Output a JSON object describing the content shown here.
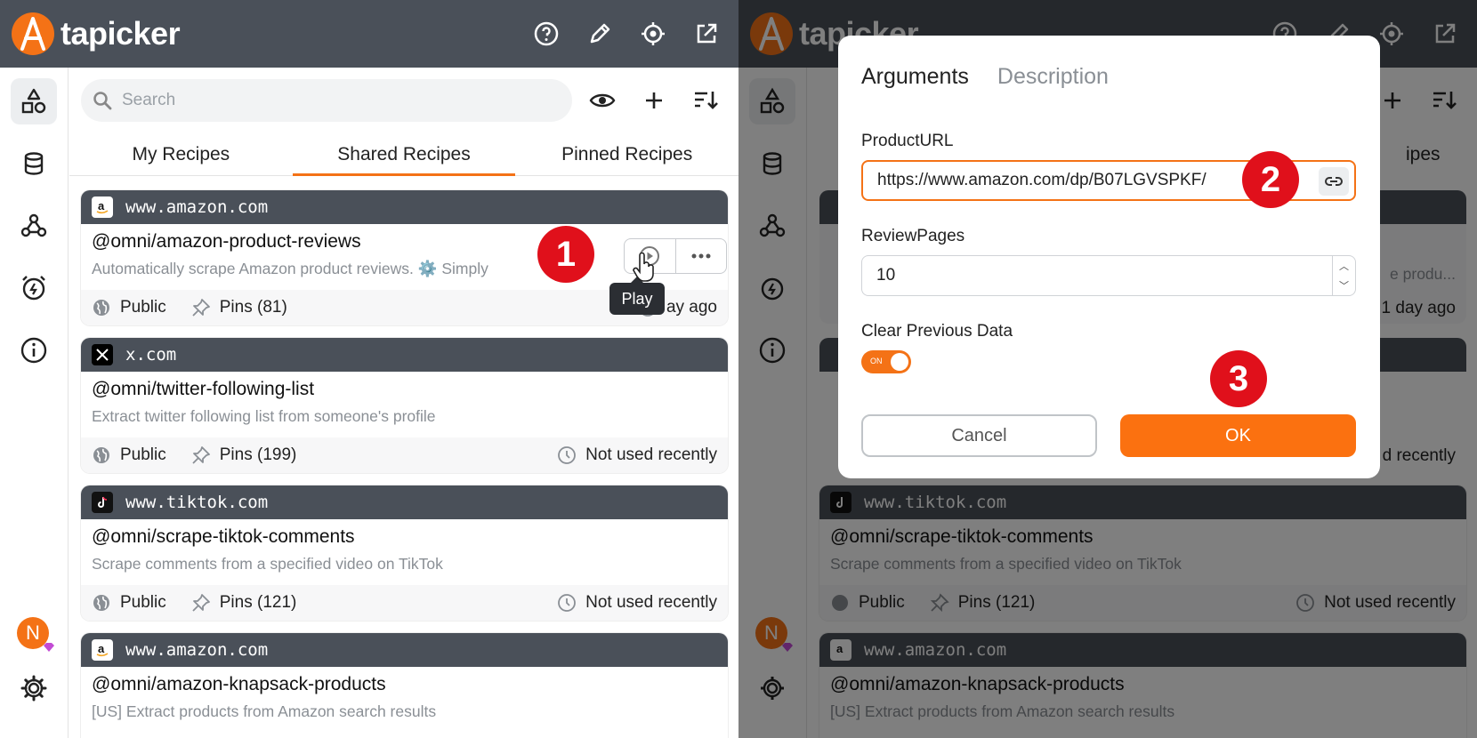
{
  "app": {
    "name": "tapicker"
  },
  "search": {
    "placeholder": "Search"
  },
  "tabs": [
    "My Recipes",
    "Shared Recipes",
    "Pinned Recipes"
  ],
  "recipes": [
    {
      "domain": "www.amazon.com",
      "title": "@omni/amazon-product-reviews",
      "desc": "Automatically scrape Amazon product reviews. ⚙️ Simply",
      "visibility": "Public",
      "pins": "Pins (81)",
      "usage": "1 day ago",
      "usage_partial": "ay ago"
    },
    {
      "domain": "x.com",
      "title": "@omni/twitter-following-list",
      "desc": "Extract twitter following list from someone's profile",
      "visibility": "Public",
      "pins": "Pins (199)",
      "usage": "Not used recently"
    },
    {
      "domain": "www.tiktok.com",
      "title": "@omni/scrape-tiktok-comments",
      "desc": "Scrape comments from a specified video on TikTok",
      "visibility": "Public",
      "pins": "Pins (121)",
      "usage": "Not used recently"
    },
    {
      "domain": "www.amazon.com",
      "title": "@omni/amazon-knapsack-products",
      "desc": "[US] Extract products from Amazon search results"
    }
  ],
  "right_bg": {
    "tab_partial": "ipes",
    "desc_partial": "e produ...",
    "usage1": "1 day ago",
    "usage2_partial": "d recently"
  },
  "tooltip": "Play",
  "avatar_initial": "N",
  "steps": [
    "1",
    "2",
    "3"
  ],
  "modal": {
    "tabs": [
      "Arguments",
      "Description"
    ],
    "fields": [
      {
        "label": "ProductURL",
        "value": "https://www.amazon.com/dp/B07LGVSPKF/"
      },
      {
        "label": "ReviewPages",
        "value": "10"
      },
      {
        "label": "Clear Previous Data",
        "toggle": "ON"
      }
    ],
    "cancel": "Cancel",
    "ok": "OK"
  },
  "colors": {
    "accent": "#f47216",
    "header": "#4a5059",
    "badge": "#e0101b"
  }
}
